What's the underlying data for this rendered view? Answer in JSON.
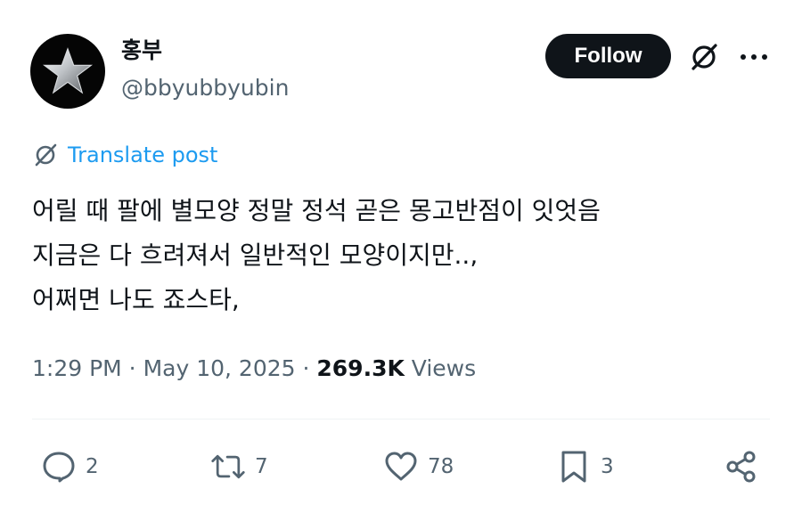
{
  "author": {
    "display_name": "홍부",
    "handle": "@bbyubbyubin"
  },
  "header": {
    "follow_label": "Follow"
  },
  "translate": {
    "label": "Translate post"
  },
  "post": {
    "lines": [
      "어릴 때 팔에 별모양 정말 정석 곧은 몽고반점이 잇엇음",
      "지금은 다 흐려져서 일반적인 모양이지만..,",
      "어쩌면 나도 죠스타,"
    ]
  },
  "meta": {
    "time": "1:29 PM",
    "sep1": " · ",
    "date": "May 10, 2025",
    "sep2": " · ",
    "views_count": "269.3K",
    "views_label": " Views"
  },
  "actions": {
    "replies": "2",
    "reposts": "7",
    "likes": "78",
    "bookmarks": "3"
  },
  "icons": {
    "avatar": "silver-star-icon",
    "grok": "grok-slash-circle-icon",
    "more": "more-horizontal-icon",
    "translate": "grok-slash-circle-icon",
    "reply": "speech-bubble-icon",
    "repost": "repost-arrows-icon",
    "like": "heart-icon",
    "bookmark": "bookmark-icon",
    "share": "share-nodes-icon"
  },
  "colors": {
    "accent": "#1d9bf0",
    "text": "#0f1419",
    "secondary": "#536471",
    "follow_bg": "#0f1419"
  }
}
